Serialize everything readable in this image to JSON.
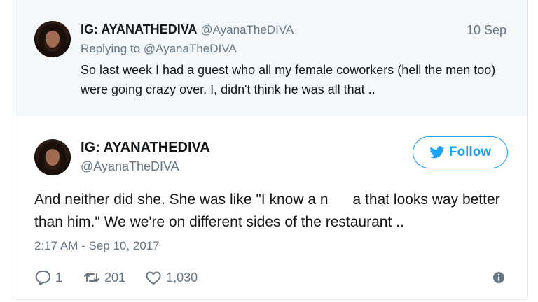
{
  "parent_tweet": {
    "display_name": "IG: AYANATHEDIVA",
    "handle": "@AyanaTheDIVA",
    "date": "10 Sep",
    "replying_prefix": "Replying to",
    "replying_handle": "@AyanaTheDIVA",
    "text": "So last week I had a guest who all my female coworkers (hell the men too) were going crazy over. I, didn't think he was all that .."
  },
  "main_tweet": {
    "display_name": "IG: AYANATHEDIVA",
    "handle": "@AyanaTheDIVA",
    "follow_label": "Follow",
    "text": "And neither did she. She was like \"I know a n      a that looks way better than him.\" We we're on different sides of the restaurant ..",
    "timestamp": "2:17 AM - Sep 10, 2017",
    "replies": "1",
    "retweets": "201",
    "likes": "1,030"
  },
  "icons": {
    "reply": "reply-icon",
    "retweet": "retweet-icon",
    "like": "heart-icon",
    "info": "info-icon",
    "follow": "twitter-bird-icon"
  },
  "colors": {
    "accent": "#1da1f2",
    "muted": "#657786",
    "parent_bg": "#f5f8fa"
  }
}
